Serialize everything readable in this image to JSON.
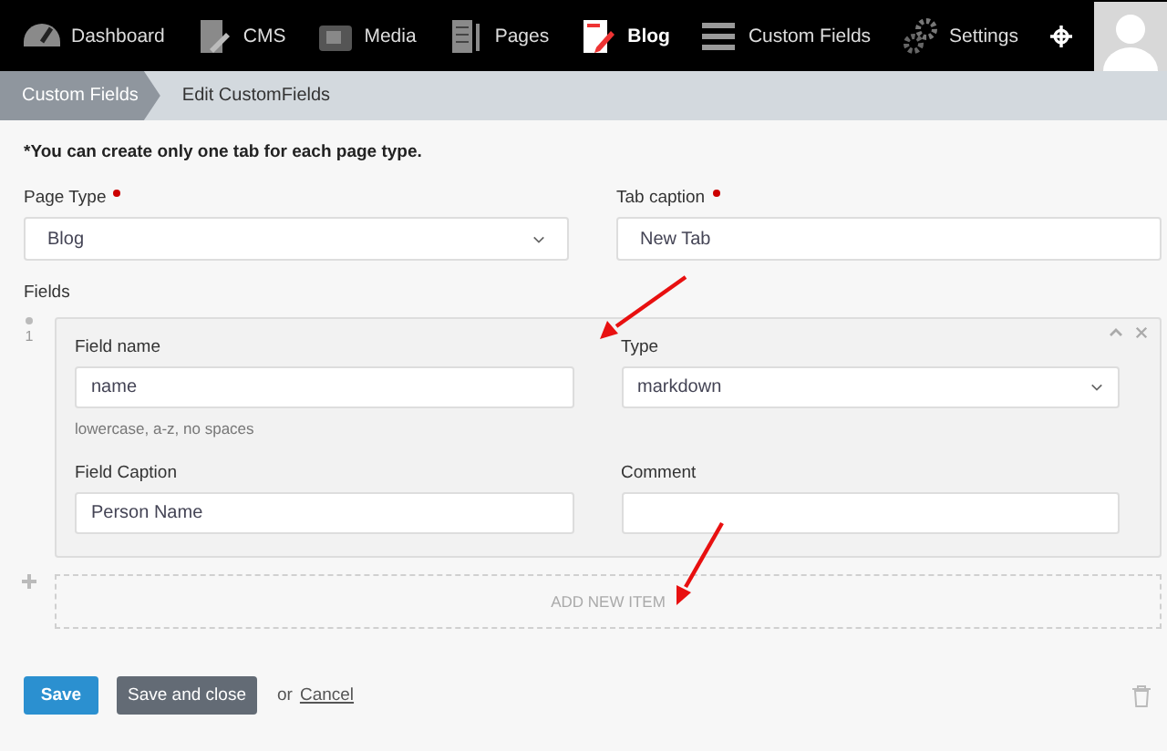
{
  "nav": [
    {
      "kind": "dashboard",
      "label": "Dashboard",
      "selected": false
    },
    {
      "kind": "cms",
      "label": "CMS",
      "selected": false
    },
    {
      "kind": "media",
      "label": "Media",
      "selected": false
    },
    {
      "kind": "pages",
      "label": "Pages",
      "selected": false
    },
    {
      "kind": "blog",
      "label": "Blog",
      "selected": true
    },
    {
      "kind": "list",
      "label": "Custom Fields",
      "selected": false
    },
    {
      "kind": "settings",
      "label": "Settings",
      "selected": false
    }
  ],
  "breadcrumb": [
    "Custom Fields",
    "Edit CustomFields"
  ],
  "note": "*You can create only one tab for each page type.",
  "page_type": {
    "label": "Page Type",
    "required": true,
    "value": "Blog"
  },
  "tab_caption": {
    "label": "Tab caption",
    "required": true,
    "value": "New Tab"
  },
  "fields_label": "Fields",
  "items": [
    {
      "number": "1",
      "field_name": {
        "label": "Field name",
        "value": "name",
        "hint": "lowercase, a-z, no spaces"
      },
      "type": {
        "label": "Type",
        "value": "markdown"
      },
      "field_caption": {
        "label": "Field Caption",
        "value": "Person Name"
      },
      "comment": {
        "label": "Comment"
      }
    }
  ],
  "add_item": "ADD NEW ITEM",
  "buttons": {
    "save": "Save",
    "save_close": "Save and close",
    "or": "or",
    "cancel": "Cancel"
  }
}
